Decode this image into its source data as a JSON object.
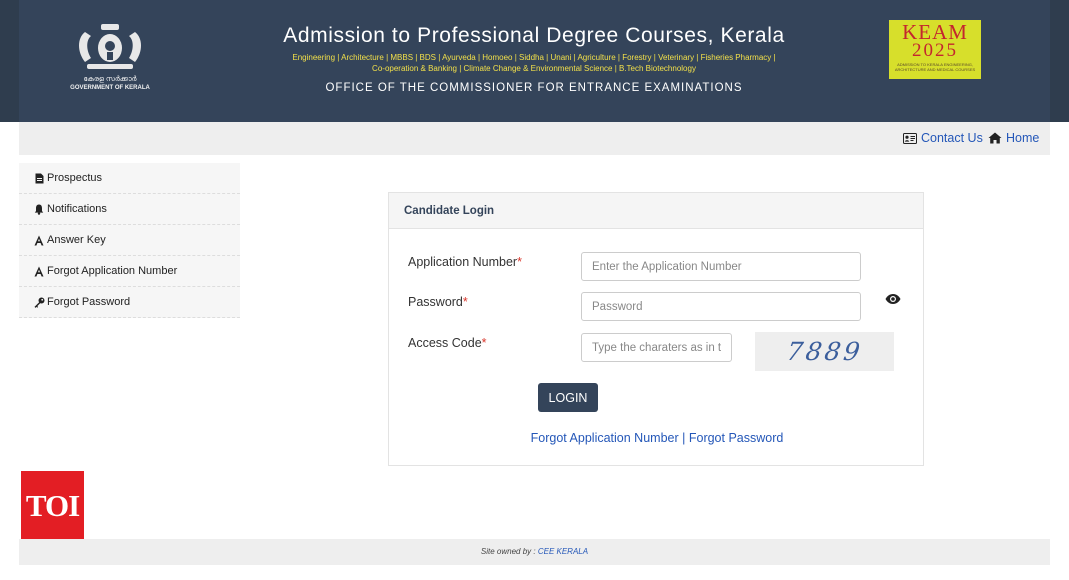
{
  "header": {
    "emblem_malayalam": "കേരള സർക്കാർ",
    "emblem_caption": "GOVERNMENT OF KERALA",
    "title": "Admission to Professional Degree Courses, Kerala",
    "courses": "Engineering | Architecture | MBBS | BDS | Ayurveda | Homoeo | Siddha | Unani | Agriculture | Forestry | Veterinary | Fisheries Pharmacy | Co-operation & Banking | Climate Change & Environmental Science | B.Tech Biotechnology",
    "office": "OFFICE OF THE COMMISSIONER FOR ENTRANCE EXAMINATIONS",
    "keam_word": "KEAM",
    "keam_year": "2025",
    "keam_sub": "ADMISSION TO KERALA ENGINEERING, ARCHITECTURE AND MEDICAL COURSES"
  },
  "topnav": {
    "contact_label": "Contact Us",
    "home_label": "Home"
  },
  "sidebar": {
    "items": [
      {
        "label": "Prospectus",
        "icon": "file-icon"
      },
      {
        "label": "Notifications",
        "icon": "bell-icon"
      },
      {
        "label": "Answer Key",
        "icon": "letter-a-icon"
      },
      {
        "label": "Forgot Application Number",
        "icon": "letter-a-icon"
      },
      {
        "label": "Forgot Password",
        "icon": "key-icon"
      }
    ]
  },
  "login": {
    "heading": "Candidate Login",
    "app_label": "Application Number",
    "app_placeholder": "Enter the Application Number",
    "password_label": "Password",
    "password_placeholder": "Password",
    "code_label": "Access Code",
    "code_placeholder": "Type the charaters as in the image",
    "required_mark": "*",
    "captcha_text": "7889",
    "button_label": "LOGIN",
    "forgot_app": "Forgot Application Number",
    "separator": "|",
    "forgot_password": "Forgot Password"
  },
  "watermark": {
    "toi": "TOI"
  },
  "footer": {
    "prefix": "Site owned by : ",
    "owner": "CEE KERALA"
  },
  "colors": {
    "header_bg": "#34445a",
    "accent_link": "#2457b8",
    "required": "#d9362b",
    "keam_bg": "#d7df2b",
    "toi_red": "#e31e24"
  }
}
